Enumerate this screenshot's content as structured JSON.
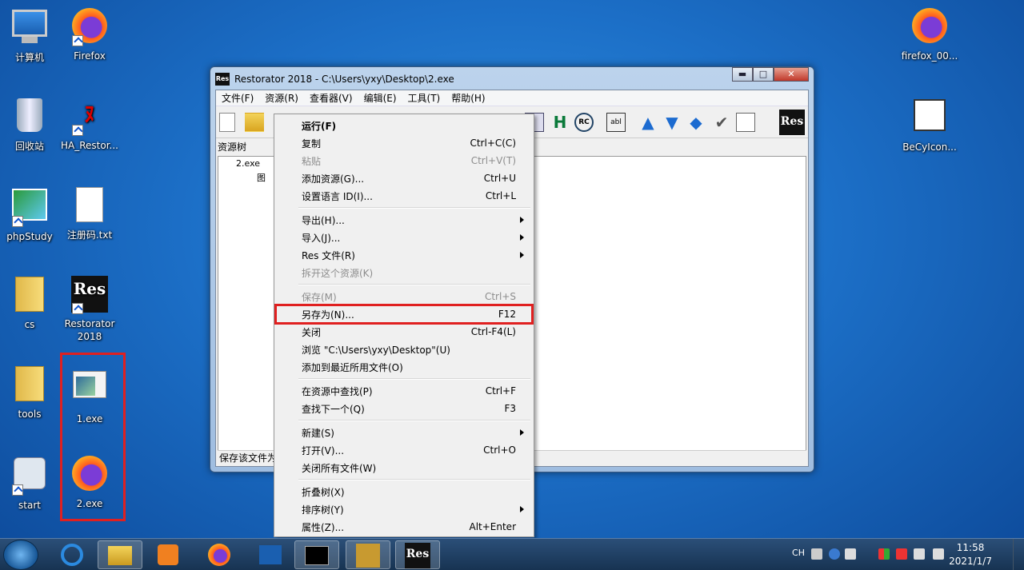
{
  "desktop": {
    "icons": [
      {
        "label": "计算机"
      },
      {
        "label": "Firefox"
      },
      {
        "label": "回收站"
      },
      {
        "label": "HA_Restor..."
      },
      {
        "label": "phpStudy"
      },
      {
        "label": "注册码.txt"
      },
      {
        "label": "cs"
      },
      {
        "label": "Restorator 2018"
      },
      {
        "label": "tools"
      },
      {
        "label": "1.exe"
      },
      {
        "label": "start"
      },
      {
        "label": "2.exe"
      },
      {
        "label": "firefox_00..."
      },
      {
        "label": "BeCyIcon..."
      }
    ]
  },
  "window": {
    "title": "Restorator 2018 - C:\\Users\\yxy\\Desktop\\2.exe",
    "logo_text": "Res",
    "controls": {
      "minimize": "▬",
      "maximize": "□",
      "close": "✕"
    },
    "menu": [
      "文件(F)",
      "资源(R)",
      "查看器(V)",
      "编辑(E)",
      "工具(T)",
      "帮助(H)"
    ],
    "tree_header": "资源树",
    "tree_items": [
      "2.exe",
      "图"
    ],
    "status": "保存该文件为"
  },
  "context_menu": {
    "items": [
      {
        "label": "运行(F)",
        "accel": "",
        "bold": true
      },
      {
        "label": "复制",
        "accel": "Ctrl+C(C)"
      },
      {
        "label": "粘贴",
        "accel": "Ctrl+V(T)",
        "disabled": true
      },
      {
        "label": "添加资源(G)...",
        "accel": "Ctrl+U"
      },
      {
        "label": "设置语言 ID(I)...",
        "accel": "Ctrl+L"
      },
      {
        "sep": true
      },
      {
        "label": "导出(H)...",
        "accel": "",
        "submenu": true
      },
      {
        "label": "导入(J)...",
        "accel": "",
        "submenu": true
      },
      {
        "label": "Res 文件(R)",
        "accel": "",
        "submenu": true
      },
      {
        "label": "拆开这个资源(K)",
        "accel": "",
        "disabled": true
      },
      {
        "sep": true
      },
      {
        "label": "保存(M)",
        "accel": "Ctrl+S",
        "disabled": true
      },
      {
        "label": "另存为(N)...",
        "accel": "F12",
        "boxed": true
      },
      {
        "label": "关闭",
        "accel": "Ctrl-F4(L)"
      },
      {
        "label": "浏览 \"C:\\Users\\yxy\\Desktop\"(U)",
        "accel": ""
      },
      {
        "label": "添加到最近所用文件(O)",
        "accel": ""
      },
      {
        "sep": true
      },
      {
        "label": "在资源中查找(P)",
        "accel": "Ctrl+F"
      },
      {
        "label": "查找下一个(Q)",
        "accel": "F3"
      },
      {
        "sep": true
      },
      {
        "label": "新建(S)",
        "accel": "",
        "submenu": true
      },
      {
        "label": "打开(V)...",
        "accel": "Ctrl+O"
      },
      {
        "label": "关闭所有文件(W)",
        "accel": ""
      },
      {
        "sep": true
      },
      {
        "label": "折叠树(X)",
        "accel": ""
      },
      {
        "label": "排序树(Y)",
        "accel": "",
        "submenu": true
      },
      {
        "label": "属性(Z)...",
        "accel": "Alt+Enter"
      }
    ]
  },
  "taskbar": {
    "lang": "CH",
    "time": "11:58",
    "date": "2021/1/7",
    "res_label": "Res"
  }
}
